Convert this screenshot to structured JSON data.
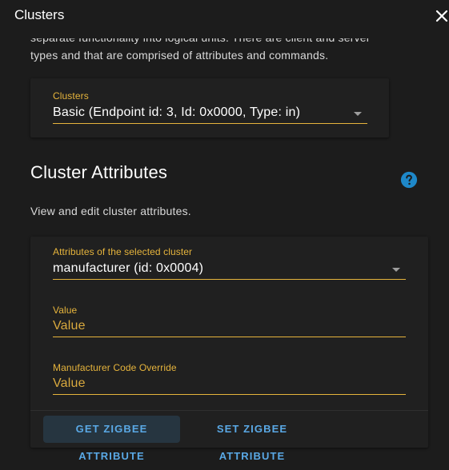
{
  "dialog": {
    "title": "Clusters"
  },
  "intro_text": "separate functionality into logical units. There are client and server types and that are comprised of attributes and commands.",
  "clusters_select": {
    "label": "Clusters",
    "value": "Basic (Endpoint id: 3, Id: 0x0000, Type: in)"
  },
  "attributes_section": {
    "title": "Cluster Attributes",
    "description": "View and edit cluster attributes.",
    "attribute_select": {
      "label": "Attributes of the selected cluster",
      "value": "manufacturer (id: 0x0004)"
    },
    "value_field": {
      "label": "Value",
      "placeholder": "Value"
    },
    "manufacturer_override_field": {
      "label": "Manufacturer Code Override",
      "placeholder": "Value"
    },
    "buttons": {
      "get": "GET ZIGBEE ATTRIBUTE",
      "set": "SET ZIGBEE ATTRIBUTE"
    }
  },
  "colors": {
    "accent": "#e6b43c",
    "button_text": "#5aa9e6",
    "help_icon": "#1e88c9"
  },
  "icons": {
    "close": "close-icon",
    "help": "help-circle-icon",
    "dropdown": "caret-down-icon"
  }
}
